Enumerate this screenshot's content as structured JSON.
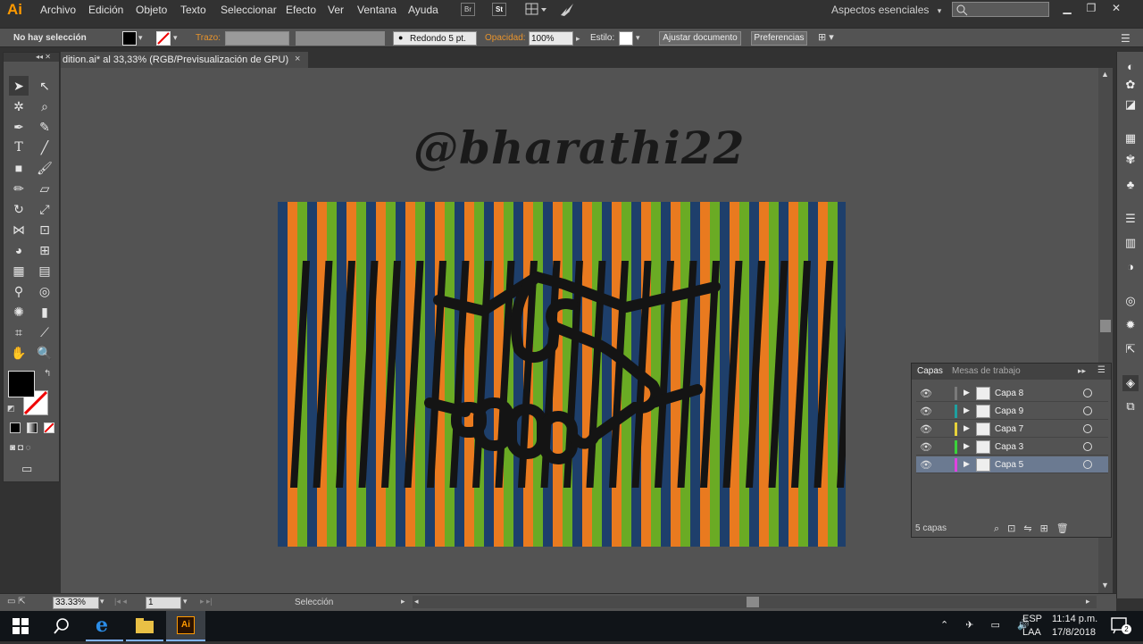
{
  "app": {
    "logo": "Ai",
    "menu": [
      "Archivo",
      "Edición",
      "Objeto",
      "Texto",
      "Seleccionar",
      "Efecto",
      "Ver",
      "Ventana",
      "Ayuda"
    ],
    "bridge_label": "Br",
    "stock_label": "St",
    "workspace": "Aspectos esenciales"
  },
  "control": {
    "selection_state": "No hay selección",
    "stroke_label": "Trazo:",
    "brush_value": "Redondo 5 pt.",
    "opacity_label": "Opacidad:",
    "opacity_value": "100%",
    "style_label": "Estilo:",
    "fit_button": "Ajustar documento",
    "prefs_button": "Preferencias"
  },
  "document": {
    "tab_label": "dition.ai* al 33,33% (RGB/Previsualización de GPU)",
    "close": "×",
    "artwork_text": "@bharathi22"
  },
  "artwork_colors": [
    "#1e3f6b",
    "#e97a1f",
    "#6aab24"
  ],
  "layers": {
    "tab_layers": "Capas",
    "tab_artboards": "Mesas de trabajo",
    "rows": [
      {
        "name": "Capa 8",
        "color": "#7a7a7a",
        "selected": false
      },
      {
        "name": "Capa 9",
        "color": "#1ea0a0",
        "selected": false
      },
      {
        "name": "Capa 7",
        "color": "#e7d23a",
        "selected": false
      },
      {
        "name": "Capa 3",
        "color": "#3ad43a",
        "selected": false
      },
      {
        "name": "Capa 5",
        "color": "#e040e0",
        "selected": true
      }
    ],
    "count": "5 capas"
  },
  "status": {
    "zoom": "33.33%",
    "artboard": "1",
    "tool": "Selección"
  },
  "taskbar": {
    "lang1": "ESP",
    "lang2": "LAA",
    "time": "11:14 p.m.",
    "date": "17/8/2018",
    "notif": "2"
  }
}
